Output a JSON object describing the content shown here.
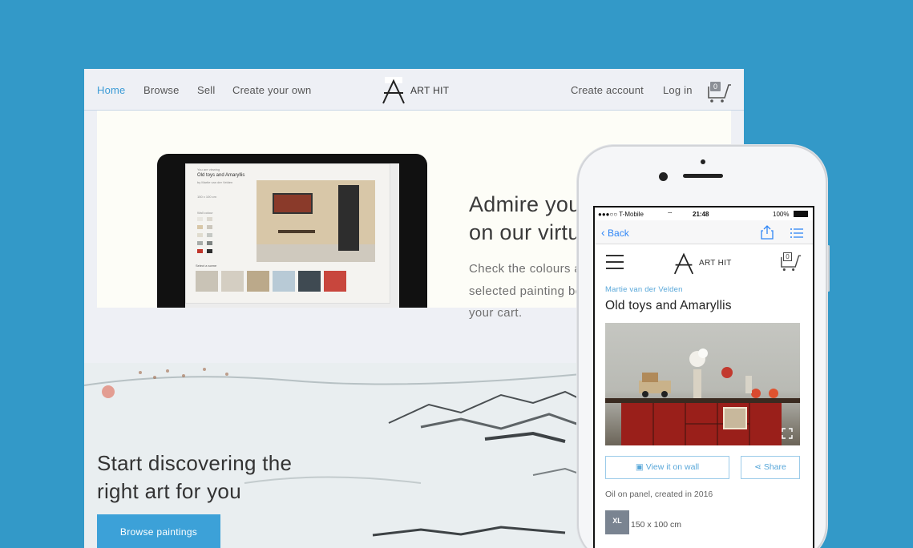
{
  "desktop": {
    "nav": {
      "home": "Home",
      "browse": "Browse",
      "sell": "Sell",
      "create_own": "Create your own",
      "logo": "ART HIT",
      "create_account": "Create account",
      "login": "Log in",
      "cart_count": "0"
    },
    "hero": {
      "heading_line1": "Admire your",
      "heading_line2": "on our virtu",
      "text_line1": "Check the colours ar",
      "text_line2": "selected painting bef",
      "text_line3": "your cart."
    },
    "tablet": {
      "small_label": "You are viewing",
      "title": "Old toys and Amaryllis",
      "artist": "by Martie van der Velden",
      "size": "150 x 100 cm",
      "wall_colour": "Wall colour",
      "select_scene": "Select a scene"
    },
    "discover": {
      "heading_line1": "Start discovering the",
      "heading_line2": "right art for you",
      "button": "Browse paintings"
    }
  },
  "phone": {
    "status": {
      "carrier": "●●●○○ T-Mobile",
      "time": "21:48",
      "battery": "100%"
    },
    "back": "Back",
    "logo": "ART HIT",
    "cart_count": "0",
    "artist": "Martie van der Velden",
    "title": "Old toys and Amaryllis",
    "view_on_wall": "View it on wall",
    "share": "Share",
    "meta": "Oil on panel, created in 2016",
    "size_badge": "XL",
    "size": "150 x 100 cm"
  },
  "colors": {
    "background": "#3399c8",
    "accent": "#3ca1d8",
    "link": "#58a7d9"
  }
}
